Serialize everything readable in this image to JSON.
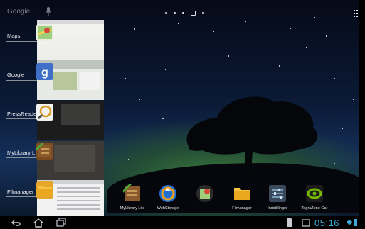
{
  "search": {
    "label": "Google"
  },
  "recent_apps": [
    {
      "label": "Maps",
      "icon": "maps-icon"
    },
    {
      "label": "Google",
      "icon": "google-search-icon"
    },
    {
      "label": "PressReader",
      "icon": "pressreader-icon"
    },
    {
      "label": "MyLibrary L",
      "icon": "mylibrary-icon"
    },
    {
      "label": "Filmanager",
      "icon": "folder-icon"
    }
  ],
  "dock": [
    {
      "label": "MyLibrary Lite",
      "icon": "mylibrary-icon"
    },
    {
      "label": "WebStorage",
      "icon": "webstorage-icon"
    },
    {
      "label": "",
      "icon": "maps-icon"
    },
    {
      "label": "Filmanager",
      "icon": "folder-icon"
    },
    {
      "label": "Indstillinger",
      "icon": "settings-icon"
    },
    {
      "label": "TegraZone Gar",
      "icon": "nvidia-icon"
    }
  ],
  "status": {
    "time": "05:16"
  },
  "colors": {
    "accent": "#3ea8d8"
  }
}
